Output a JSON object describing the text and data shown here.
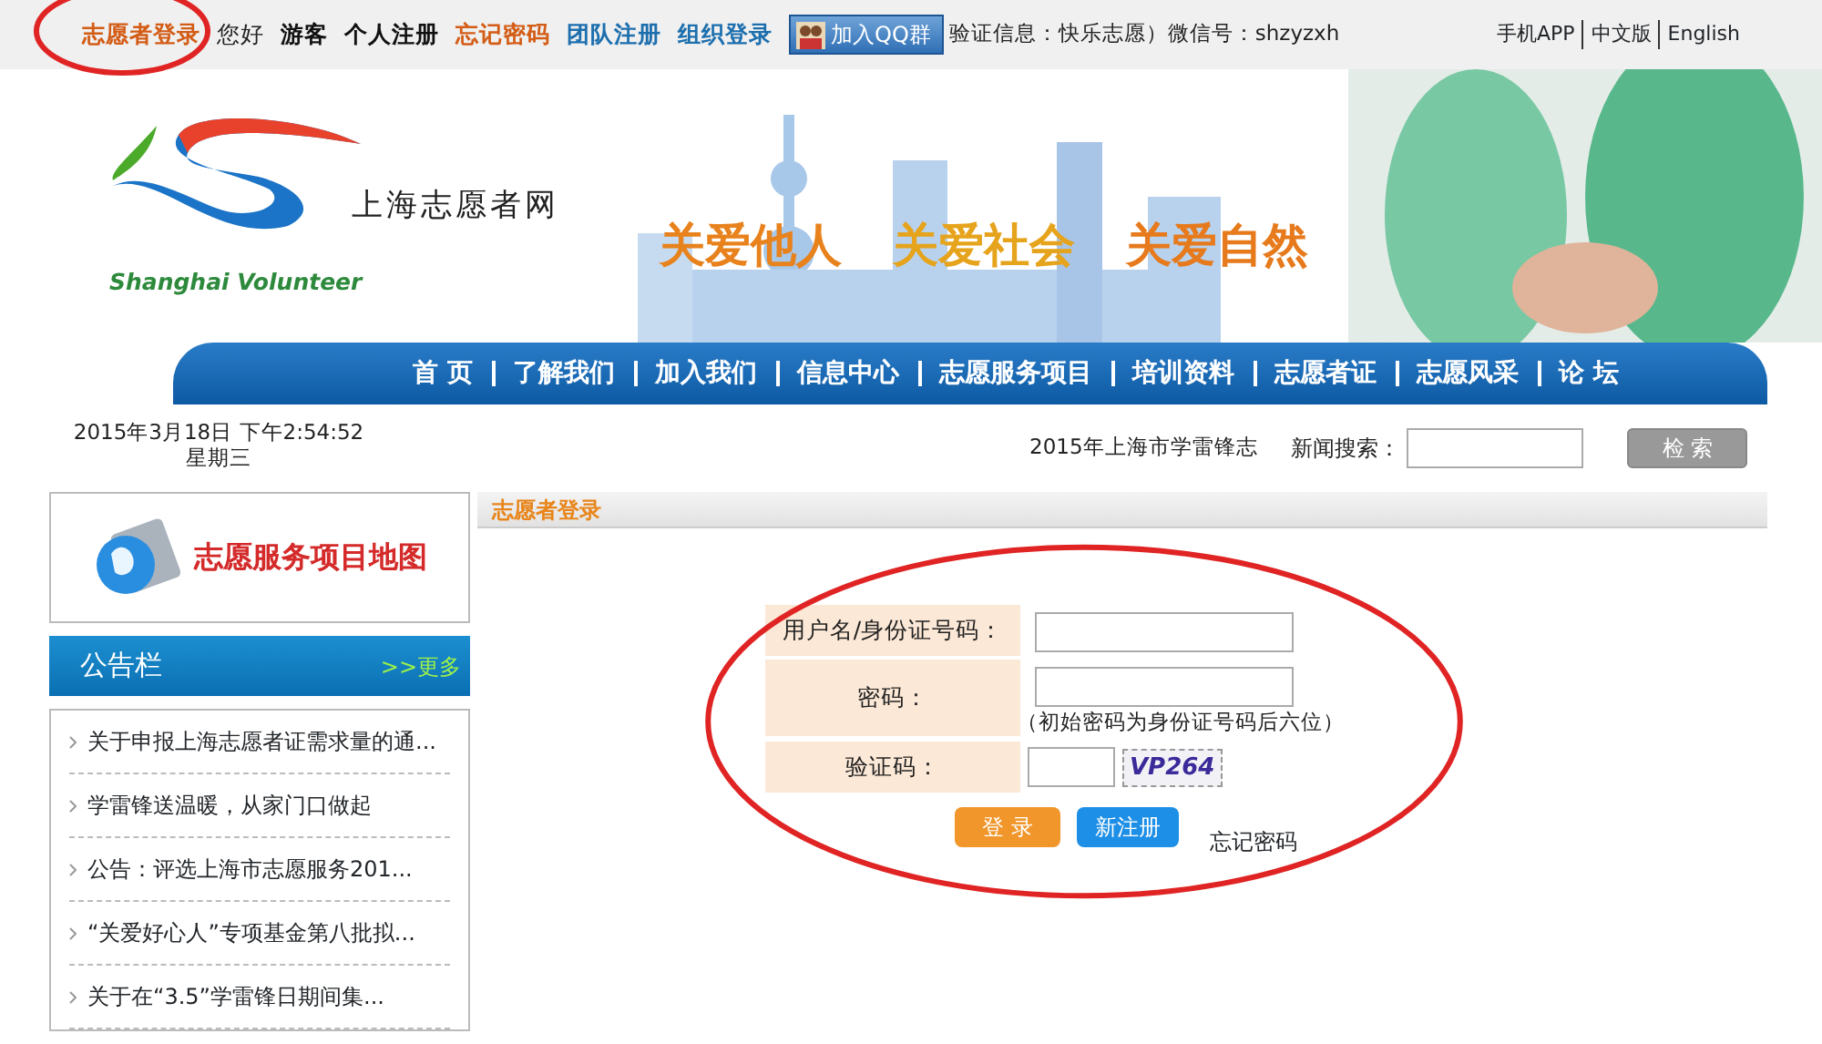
{
  "top_bar": {
    "links": [
      {
        "label": "志愿者登录",
        "kind": "orange"
      },
      {
        "label": "您好",
        "kind": "plain"
      },
      {
        "label": "游客",
        "kind": "dark"
      },
      {
        "label": "个人注册",
        "kind": "dark"
      },
      {
        "label": "忘记密码",
        "kind": "orange"
      },
      {
        "label": "团队注册",
        "kind": "blue"
      },
      {
        "label": "组织登录",
        "kind": "blue"
      }
    ],
    "qq_button": "加入QQ群",
    "verify_info": "验证信息：快乐志愿）微信号：shzyzxh",
    "right_links": [
      "手机APP",
      "中文版",
      "English"
    ]
  },
  "header": {
    "site_name": "上海志愿者网",
    "logo_text": "Shanghai Volunteer",
    "slogans": [
      "关爱他人",
      "关爱社会",
      "关爱自然"
    ]
  },
  "nav": [
    "首 页",
    "了解我们",
    "加入我们",
    "信息中心",
    "志愿服务项目",
    "培训资料",
    "志愿者证",
    "志愿风采",
    "论 坛"
  ],
  "info_bar": {
    "datetime": "2015年3月18日 下午2:54:52 星期三",
    "ticker": "2015年上海市学雷锋志",
    "search_label": "新闻搜索：",
    "search_button": "检 索"
  },
  "sidebar": {
    "map_link": "志愿服务项目地图",
    "notice_title": "公告栏",
    "more": ">>更多",
    "notices": [
      "关于申报上海志愿者证需求量的通...",
      "学雷锋送温暖，从家门口做起",
      "公告：评选上海市志愿服务201...",
      "“关爱好心人”专项基金第八批拟...",
      "关于在“3.5”学雷锋日期间集..."
    ]
  },
  "login": {
    "title": "志愿者登录",
    "fields": [
      {
        "label": "用户名/身份证号码：",
        "kind": "text"
      },
      {
        "label": "密码：",
        "kind": "password",
        "hint": "（初始密码为身份证号码后六位）"
      },
      {
        "label": "验证码：",
        "kind": "captcha",
        "captcha": "VP264"
      }
    ],
    "login_button": "登 录",
    "register_button": "新注册",
    "forgot_link": "忘记密码"
  },
  "annotations": [
    {
      "kind": "ellipse"
    },
    {
      "kind": "ellipse"
    }
  ]
}
